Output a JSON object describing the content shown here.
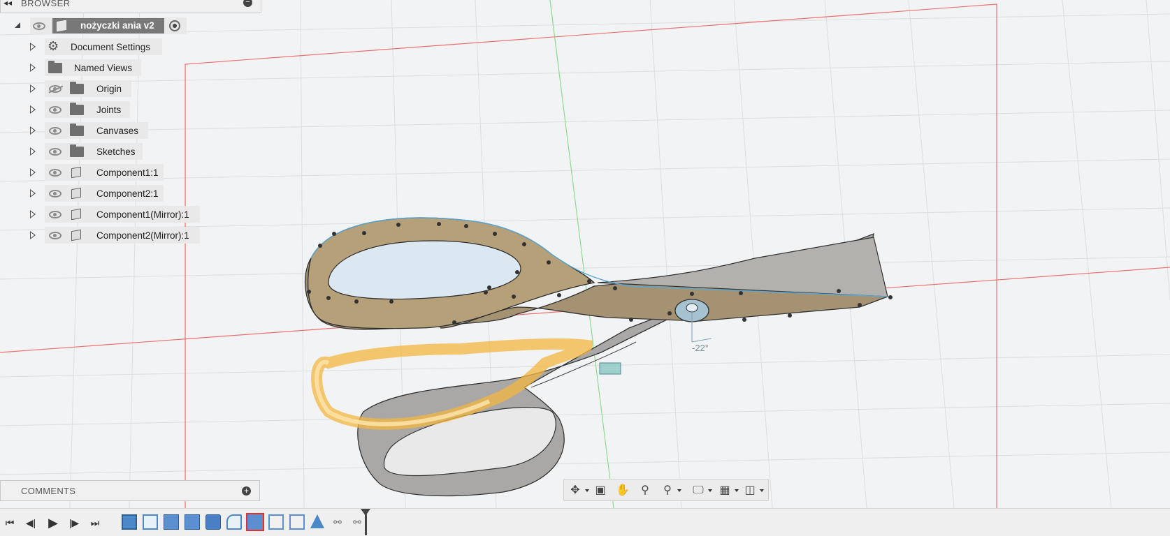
{
  "browser": {
    "title": "BROWSER",
    "root_label": "nożyczki ania v2",
    "items": [
      {
        "label": "Document Settings",
        "icon": "gear-icon"
      },
      {
        "label": "Named Views",
        "icon": "folder-icon"
      },
      {
        "label": "Origin",
        "icon": "folder-icon",
        "visibility": "hidden"
      },
      {
        "label": "Joints",
        "icon": "folder-icon",
        "visibility": "visible"
      },
      {
        "label": "Canvases",
        "icon": "folder-icon",
        "visibility": "visible"
      },
      {
        "label": "Sketches",
        "icon": "folder-icon",
        "visibility": "visible"
      },
      {
        "label": "Component1:1",
        "icon": "component-anchored-icon",
        "visibility": "visible"
      },
      {
        "label": "Component2:1",
        "icon": "component-icon",
        "visibility": "visible"
      },
      {
        "label": "Component1(Mirror):1",
        "icon": "component-icon",
        "visibility": "visible"
      },
      {
        "label": "Component2(Mirror):1",
        "icon": "component-icon",
        "visibility": "visible"
      }
    ]
  },
  "comments": {
    "title": "COMMENTS"
  },
  "viewport": {
    "angle_label": "-22°",
    "colors": {
      "axis_red": "#ef6f6f",
      "axis_green": "#8fd98f",
      "highlight_orange": "#f0a820",
      "selection_blue": "#5aa8d6"
    }
  },
  "navbar": {
    "tools": [
      "orbit-icon",
      "look-at-icon",
      "pan-icon",
      "zoom-icon",
      "fit-icon",
      "display-settings-icon",
      "grid-settings-icon",
      "viewports-icon"
    ]
  },
  "timeline": {
    "controls": [
      "skip-start-icon",
      "step-back-icon",
      "play-icon",
      "step-forward-icon",
      "skip-end-icon"
    ],
    "features": [
      "canvas-icon",
      "sketch-icon",
      "extrude-icon",
      "extrude-icon",
      "combine-icon",
      "fillet-icon",
      "joint-icon",
      "component-icon",
      "component-icon",
      "mirror-icon",
      "joint-icon",
      "joint-icon"
    ]
  }
}
